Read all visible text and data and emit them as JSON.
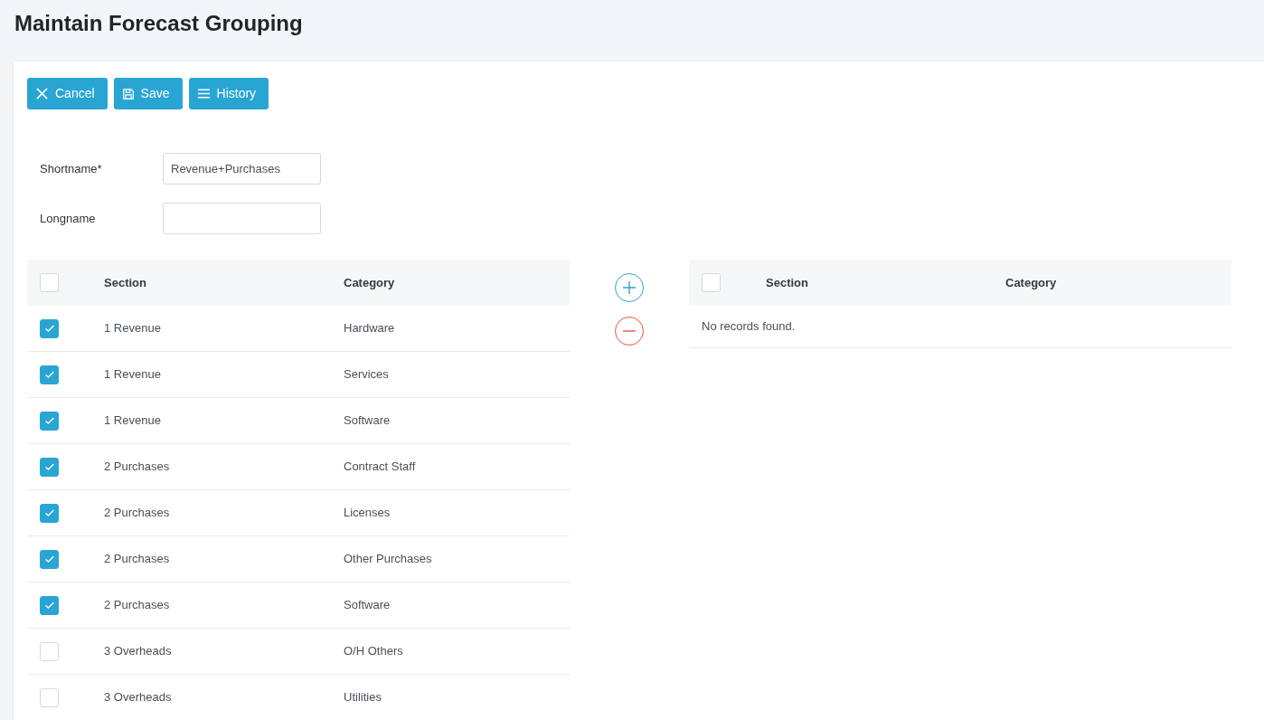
{
  "title": "Maintain Forecast Grouping",
  "toolbar": [
    {
      "kind": "cancel",
      "label": "Cancel"
    },
    {
      "kind": "save",
      "label": "Save"
    },
    {
      "kind": "history",
      "label": "History"
    }
  ],
  "fields": [
    {
      "label": "Shortname*",
      "value": "Revenue+Purchases"
    },
    {
      "label": "Longname"
    }
  ],
  "left_table": {
    "header_checked": false,
    "columns": [
      "Section",
      "Category"
    ],
    "rows": [
      {
        "checked": true,
        "section": "1 Revenue",
        "category": "Hardware"
      },
      {
        "checked": true,
        "section": "1 Revenue",
        "category": "Services"
      },
      {
        "checked": true,
        "section": "1 Revenue",
        "category": "Software"
      },
      {
        "checked": true,
        "section": "2 Purchases",
        "category": "Contract Staff"
      },
      {
        "checked": true,
        "section": "2 Purchases",
        "category": "Licenses"
      },
      {
        "checked": true,
        "section": "2 Purchases",
        "category": "Other Purchases"
      },
      {
        "checked": true,
        "section": "2 Purchases",
        "category": "Software"
      },
      {
        "checked": false,
        "section": "3 Overheads",
        "category": "O/H Others"
      },
      {
        "checked": false,
        "section": "3 Overheads",
        "category": "Utilities"
      }
    ]
  },
  "right_table": {
    "header_checked": false,
    "columns": [
      "Section",
      "Category"
    ],
    "empty_message": "No records found."
  }
}
